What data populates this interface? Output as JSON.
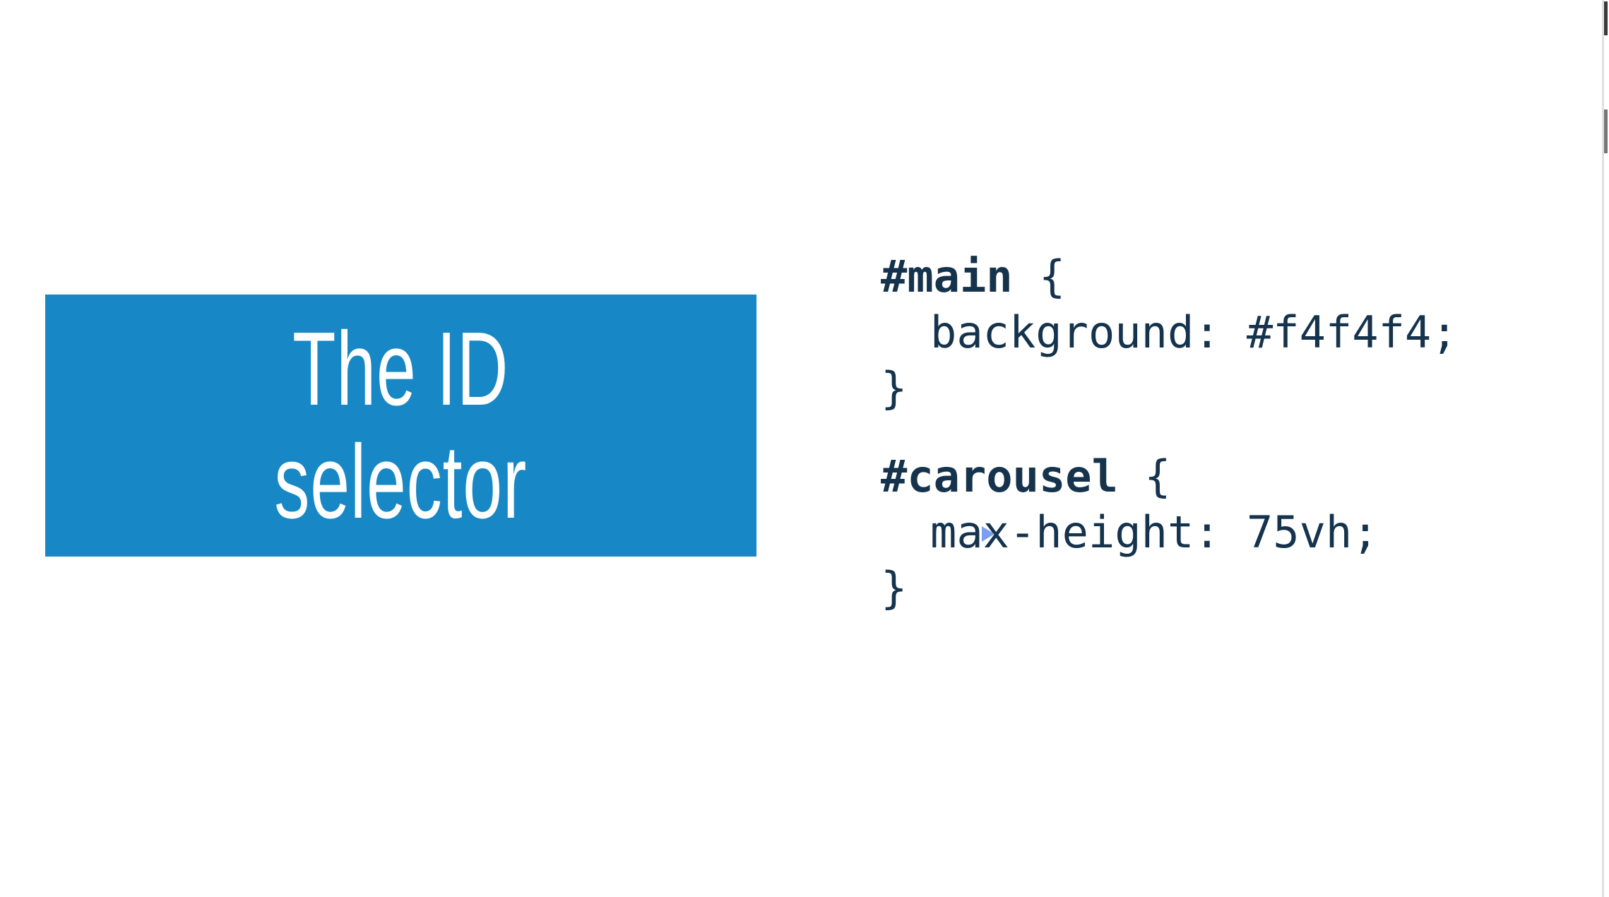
{
  "title": {
    "line1": "The ID",
    "line2": "selector"
  },
  "code": {
    "rule1": {
      "selector": "#main",
      "open": " {",
      "property": "background",
      "value": ": #f4f4f4;",
      "close": "}"
    },
    "rule2": {
      "selector": "#carousel",
      "open": " {",
      "property": "max-height",
      "value": ": 75vh;",
      "close": "}"
    }
  },
  "colors": {
    "title_box": "#1788c5",
    "title_text": "#ffffff",
    "code_text": "#15334d",
    "cursor": "#7b9ef0"
  }
}
